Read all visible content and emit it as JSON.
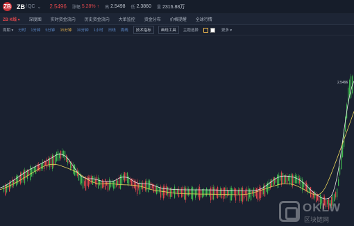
{
  "topbar": {
    "logo_text": "ZB",
    "pair_base": "ZB",
    "pair_sep": "/",
    "pair_quote": "QC",
    "price": "2.5496",
    "change_label": "涨幅",
    "change_value": "5.28% ↑",
    "high_label": "高",
    "high_value": "2.5498",
    "low_label": "低",
    "low_value": "2.3860",
    "volume_label": "量",
    "volume_value": "2316.88万"
  },
  "tabs": [
    "ZB K线 ▾",
    "深度图",
    "实时资金流向",
    "历史资金流向",
    "大单监控",
    "资金分布",
    "价格提醒",
    "全球行情"
  ],
  "toolbar": {
    "chart_type": "周期 ▾",
    "intervals": [
      "分时",
      "1分钟",
      "5分钟",
      "15分钟",
      "30分钟",
      "1小时",
      "日线",
      "周线"
    ],
    "active_interval": "15分钟",
    "indicators_button": "技术指标",
    "drawing_button": "画线工具",
    "theme_label": "主题选择",
    "more_label": "更多 ▾"
  },
  "chart": {
    "last_price_label": "2.5496",
    "up_color": "#3fb950",
    "down_color": "#e0474c",
    "ma_fast_color": "#e8e8e8",
    "ma_slow_color": "#e9d45c"
  },
  "chart_data": {
    "type": "candlestick",
    "title": "",
    "last_price": 2.5496,
    "candles": []
  },
  "watermark": {
    "text": "OKLW",
    "sub": "区块链网"
  }
}
